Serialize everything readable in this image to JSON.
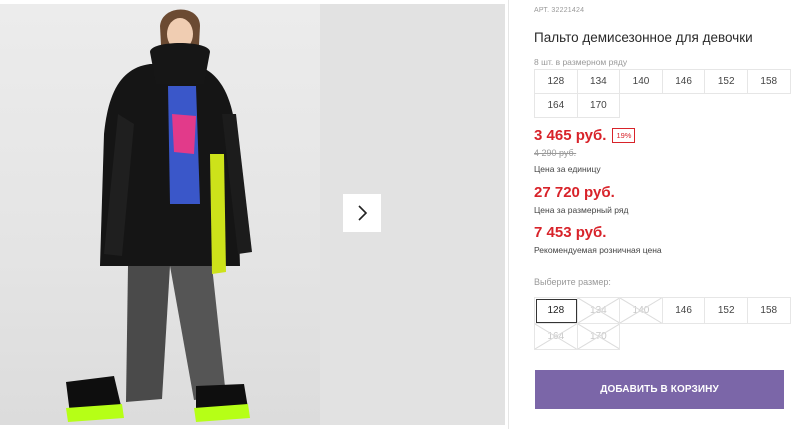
{
  "product": {
    "article": "АРТ. 32221424",
    "title": "Пальто демисезонное для девочки"
  },
  "size_range": {
    "label": "8 шт. в размерном ряду",
    "sizes": [
      "128",
      "134",
      "140",
      "146",
      "152",
      "158",
      "164",
      "170"
    ]
  },
  "prices": {
    "unit_price": "3 465 руб.",
    "discount": "19%",
    "old_price": "4 290 руб.",
    "unit_label": "Цена за единицу",
    "range_price": "27 720 руб.",
    "range_label": "Цена за размерный ряд",
    "rrp": "7 453 руб.",
    "rrp_label": "Рекомендуемая розничная цена"
  },
  "size_picker": {
    "label": "Выберите размер:",
    "sizes": [
      {
        "label": "128",
        "state": "selected"
      },
      {
        "label": "134",
        "state": "disabled"
      },
      {
        "label": "140",
        "state": "disabled"
      },
      {
        "label": "146",
        "state": "available"
      },
      {
        "label": "152",
        "state": "available"
      },
      {
        "label": "158",
        "state": "available"
      },
      {
        "label": "164",
        "state": "disabled"
      },
      {
        "label": "170",
        "state": "disabled"
      }
    ]
  },
  "cart": {
    "add_label": "ДОБАВИТЬ В КОРЗИНУ"
  },
  "colors": {
    "accent": "#7b66a8",
    "price": "#d8232a"
  }
}
